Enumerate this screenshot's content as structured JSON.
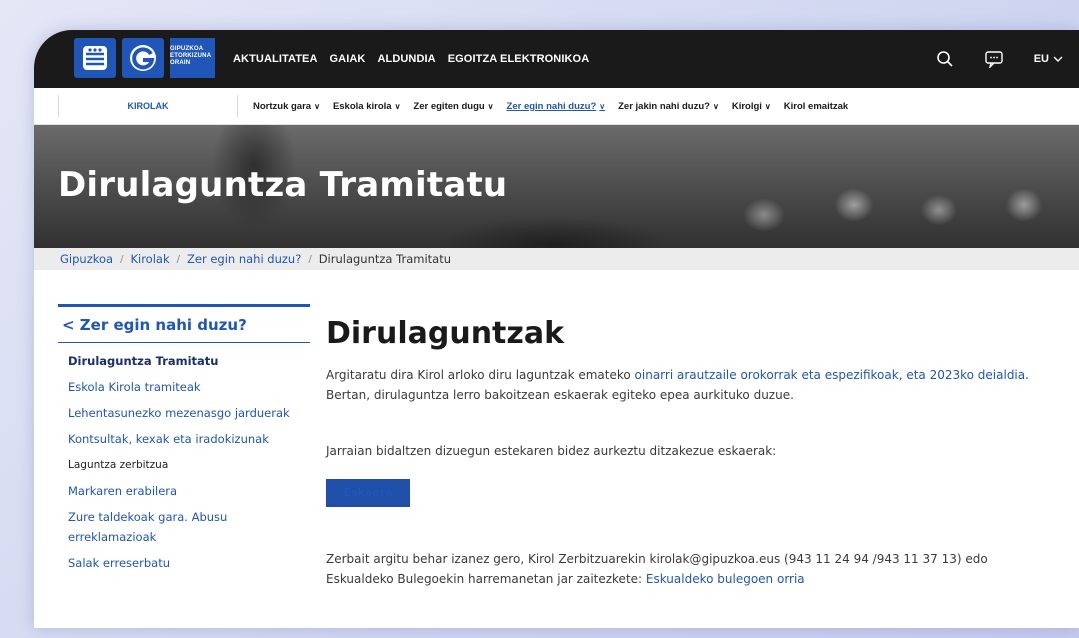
{
  "logo": {
    "lines": [
      "GIPUZKOA",
      "ETORKIZUNA",
      "ORAIN"
    ]
  },
  "main_nav": [
    "AKTUALITATEA",
    "GAIAK",
    "ALDUNDIA",
    "EGOITZA ELEKTRONIKOA"
  ],
  "lang": "EU",
  "subnav": {
    "section": "KIROLAK",
    "items": [
      {
        "label": "Nortzuk gara",
        "dropdown": true
      },
      {
        "label": "Eskola kirola",
        "dropdown": true
      },
      {
        "label": "Zer egiten dugu",
        "dropdown": true
      },
      {
        "label": "Zer egin nahi duzu?",
        "dropdown": true,
        "active": true
      },
      {
        "label": "Zer jakin nahi duzu?",
        "dropdown": true
      },
      {
        "label": "Kirolgi",
        "dropdown": true
      },
      {
        "label": "Kirol emaitzak",
        "dropdown": false
      }
    ]
  },
  "hero": {
    "title": "Dirulaguntza Tramitatu"
  },
  "breadcrumb": [
    "Gipuzkoa",
    "Kirolak",
    "Zer egin nahi duzu?",
    "Dirulaguntza Tramitatu"
  ],
  "sidebar": {
    "head": "< Zer egin nahi duzu?",
    "items": [
      "Dirulaguntza Tramitatu",
      "Eskola Kirola tramiteak",
      "Lehentasunezko mezenasgo jarduerak",
      "Kontsultak, kexak eta iradokizunak",
      "Laguntza zerbitzua",
      "Markaren erabilera",
      "Zure taldekoak gara. Abusu erreklamazioak",
      "Salak erreserbatu"
    ]
  },
  "main": {
    "title": "Dirulaguntzak",
    "p1_pre": "Argitaratu dira Kirol arloko diru laguntzak emateko ",
    "p1_link": "oinarri arautzaile orokorrak eta espezifikoak, eta 2023ko deialdia",
    "p1_post": ". Bertan, dirulaguntza lerro bakoitzean eskaerak egiteko epea aurkituko duzue.",
    "p2": "Jarraian bidaltzen dizuegun estekaren bidez aurkeztu ditzakezue eskaerak:",
    "button": "Eskaera",
    "p3_pre": "Zerbait argitu behar izanez gero, Kirol Zerbitzuarekin kirolak@gipuzkoa.eus (943 11 24 94 /943 11 37 13) edo Eskualdeko Bulegoekin harremanetan jar zaitezkete: ",
    "p3_link": "Eskualdeko bulegoen orria"
  }
}
